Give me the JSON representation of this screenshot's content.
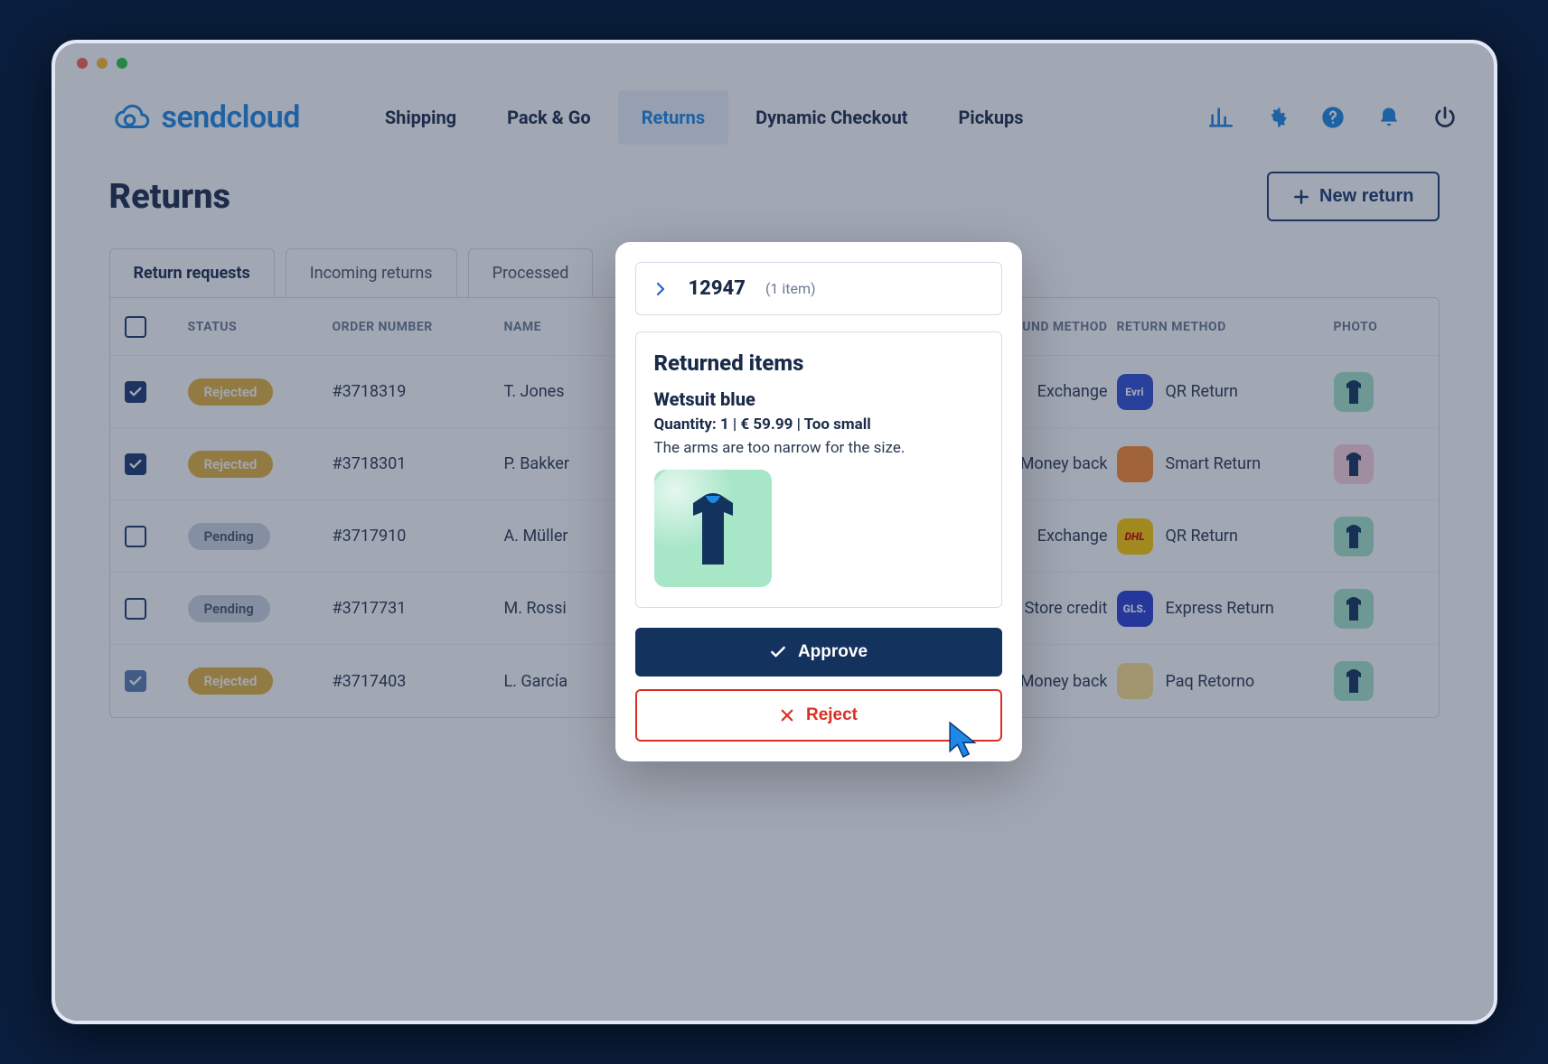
{
  "brand": "sendcloud",
  "nav": {
    "items": [
      "Shipping",
      "Pack & Go",
      "Returns",
      "Dynamic Checkout",
      "Pickups"
    ],
    "active_index": 2
  },
  "page": {
    "title": "Returns",
    "new_return_label": "New return"
  },
  "tabs": {
    "items": [
      "Return requests",
      "Incoming returns",
      "Processed"
    ],
    "active_index": 0
  },
  "columns": {
    "status": "STATUS",
    "order_number": "ORDER NUMBER",
    "name": "NAME",
    "refund_method": "REFUND METHOD",
    "return_method": "RETURN METHOD",
    "photo": "PHOTO"
  },
  "status_labels": {
    "rejected": "Rejected",
    "pending": "Pending"
  },
  "rows": [
    {
      "checked": true,
      "status": "rejected",
      "order": "#3718319",
      "name": "T. Jones",
      "refund": "Exchange",
      "carrier": "Evri",
      "carrier_color": "#2f4fd6",
      "return_method": "QR Return",
      "photo_bg": "#a8e6c8"
    },
    {
      "checked": true,
      "status": "rejected",
      "order": "#3718301",
      "name": "P. Bakker",
      "refund": "Money back",
      "carrier": "",
      "carrier_color": "#ff8c2e",
      "return_method": "Smart Return",
      "photo_bg": "#ffd3df"
    },
    {
      "checked": false,
      "status": "pending",
      "order": "#3717910",
      "name": "A. Müller",
      "refund": "Exchange",
      "carrier": "DHL",
      "carrier_color": "#ffcc00",
      "return_method": "QR Return",
      "photo_bg": "#a8e6c8"
    },
    {
      "checked": false,
      "status": "pending",
      "order": "#3717731",
      "name": "M. Rossi",
      "refund": "Store credit",
      "carrier": "GLS.",
      "carrier_color": "#2a3ed6",
      "return_method": "Express Return",
      "photo_bg": "#a8e6c8"
    },
    {
      "checked": true,
      "check_light": true,
      "status": "rejected",
      "order": "#3717403",
      "name": "L. García",
      "refund": "Money back",
      "carrier": "",
      "carrier_color": "#ffe08a",
      "return_method": "Paq Retorno",
      "photo_bg": "#a8e6c8"
    }
  ],
  "modal": {
    "order_number": "12947",
    "item_count_label": "(1 item)",
    "section_title": "Returned items",
    "product_name": "Wetsuit blue",
    "meta_line": "Quantity: 1 | € 59.99 | Too small",
    "note": "The arms are too narrow for the size.",
    "approve_label": "Approve",
    "reject_label": "Reject"
  }
}
